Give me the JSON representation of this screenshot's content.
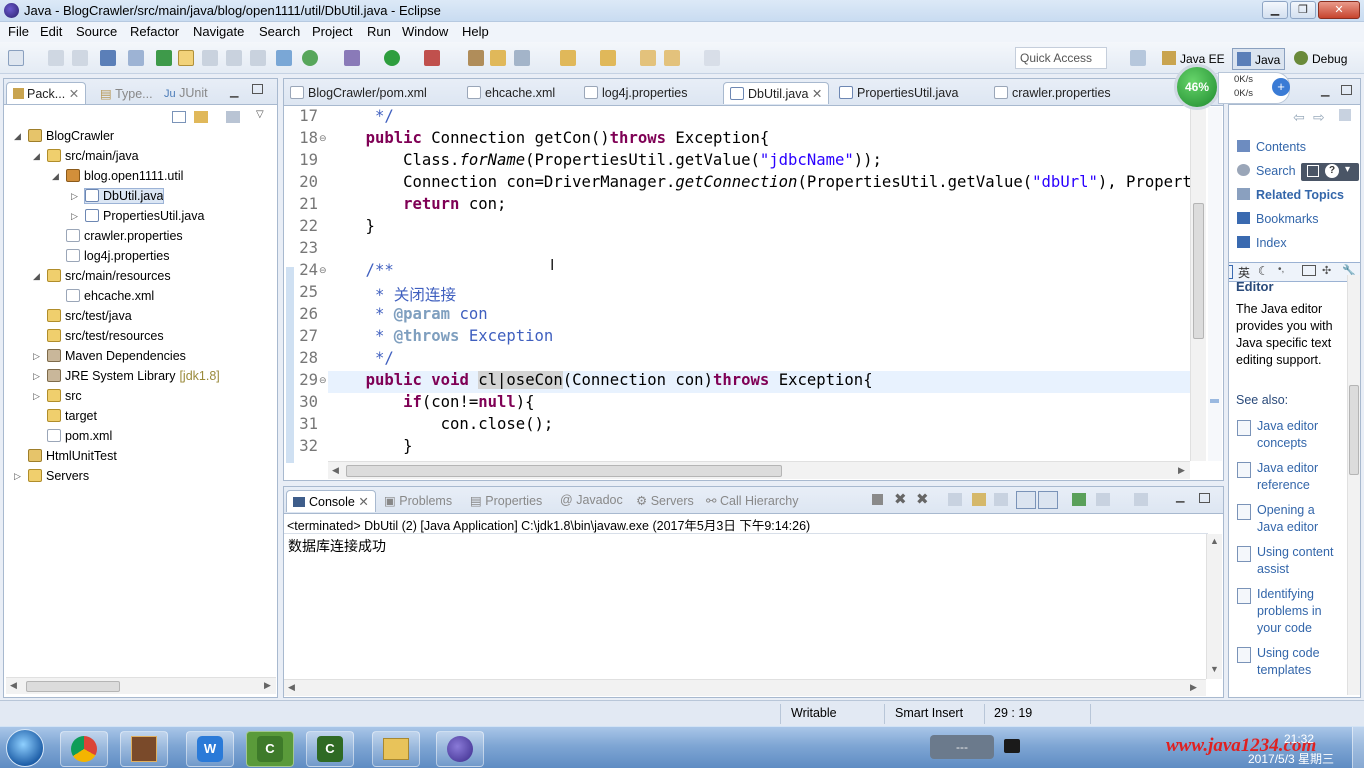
{
  "window": {
    "title": "Java - BlogCrawler/src/main/java/blog/open1111/util/DbUtil.java - Eclipse"
  },
  "menu": [
    "File",
    "Edit",
    "Source",
    "Refactor",
    "Navigate",
    "Search",
    "Project",
    "Run",
    "Window",
    "Help"
  ],
  "toolbar": {
    "quick_access_placeholder": "Quick Access",
    "perspectives": [
      "Java EE",
      "Java",
      "Debug"
    ]
  },
  "network_widget": {
    "percent": "46%",
    "up": "0K/s",
    "down": "0K/s"
  },
  "explorer": {
    "tabs": [
      "Pack...",
      "Type...",
      "JUnit"
    ],
    "items": [
      {
        "label": "BlogCrawler",
        "icon": "project-icon",
        "level": 0,
        "expand": "open"
      },
      {
        "label": "src/main/java",
        "icon": "source-folder-icon",
        "level": 1,
        "expand": "open"
      },
      {
        "label": "blog.open1111.util",
        "icon": "package-icon",
        "level": 2,
        "expand": "open"
      },
      {
        "label": "DbUtil.java",
        "icon": "java-file-icon",
        "level": 3,
        "expand": "closed",
        "selected": true
      },
      {
        "label": "PropertiesUtil.java",
        "icon": "java-file-icon",
        "level": 3,
        "expand": "closed"
      },
      {
        "label": "crawler.properties",
        "icon": "properties-file-icon",
        "level": 2,
        "expand": "none"
      },
      {
        "label": "log4j.properties",
        "icon": "properties-file-icon",
        "level": 2,
        "expand": "none"
      },
      {
        "label": "src/main/resources",
        "icon": "source-folder-icon",
        "level": 1,
        "expand": "open"
      },
      {
        "label": "ehcache.xml",
        "icon": "xml-file-icon",
        "level": 2,
        "expand": "none"
      },
      {
        "label": "src/test/java",
        "icon": "source-folder-icon",
        "level": 1,
        "expand": "none"
      },
      {
        "label": "src/test/resources",
        "icon": "source-folder-icon",
        "level": 1,
        "expand": "none"
      },
      {
        "label": "Maven Dependencies",
        "icon": "library-icon",
        "level": 1,
        "expand": "closed"
      },
      {
        "label": "JRE System Library",
        "suffix": "[jdk1.8]",
        "icon": "library-icon",
        "level": 1,
        "expand": "closed"
      },
      {
        "label": "src",
        "icon": "folder-icon",
        "level": 1,
        "expand": "closed"
      },
      {
        "label": "target",
        "icon": "folder-icon",
        "level": 1,
        "expand": "none"
      },
      {
        "label": "pom.xml",
        "icon": "xml-file-icon",
        "level": 1,
        "expand": "none"
      },
      {
        "label": "HtmlUnitTest",
        "icon": "project-icon",
        "level": 0,
        "expand": "none"
      },
      {
        "label": "Servers",
        "icon": "folder-icon",
        "level": 0,
        "expand": "closed"
      }
    ]
  },
  "editor": {
    "tabs": [
      "BlogCrawler/pom.xml",
      "ehcache.xml",
      "log4j.properties",
      "DbUtil.java",
      "PropertiesUtil.java",
      "crawler.properties"
    ],
    "active_tab": "DbUtil.java",
    "line_numbers": [
      "17",
      "18",
      "19",
      "20",
      "21",
      "22",
      "23",
      "24",
      "25",
      "26",
      "27",
      "28",
      "29",
      "30",
      "31",
      "32"
    ],
    "folded_lines": [
      "18",
      "24",
      "29"
    ]
  },
  "console": {
    "tabs": [
      "Console",
      "Problems",
      "Properties",
      "Javadoc",
      "Servers",
      "Call Hierarchy"
    ],
    "status": "<terminated> DbUtil (2) [Java Application] C:\\jdk1.8\\bin\\javaw.exe (2017年5月3日 下午9:14:26)",
    "output": "数据库连接成功"
  },
  "help": {
    "items": [
      "Contents",
      "Search",
      "Related Topics",
      "Bookmarks",
      "Index"
    ],
    "heading": "Editor",
    "body": "The Java editor provides you with Java specific text editing support.",
    "see_also": "See also:",
    "links": [
      "Java editor concepts",
      "Java editor reference",
      "Opening a Java editor",
      "Using content assist",
      "Identifying problems in your code",
      "Using code templates"
    ]
  },
  "ime_bar": {
    "lang": "英"
  },
  "statusbar": {
    "mode": "Writable",
    "insert": "Smart Insert",
    "position": "29 : 19"
  },
  "taskbar": {
    "apps": [
      "start-orb",
      "chrome-icon",
      "javaee-ide-icon",
      "wps-icon",
      "camtasia-icon",
      "camtasia-icon",
      "file-explorer-icon",
      "eclipse-icon"
    ],
    "watermark": "www.java1234.com",
    "clock_time": "21:32",
    "clock_date": "2017/5/3 星期三"
  }
}
